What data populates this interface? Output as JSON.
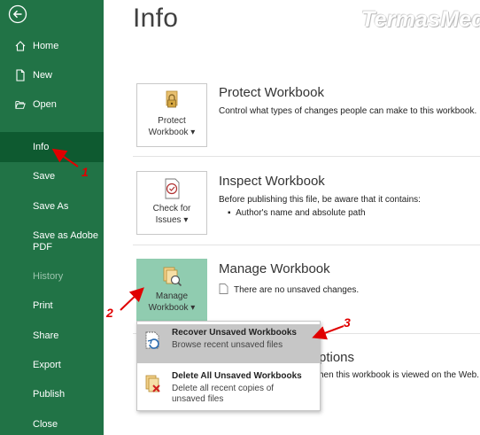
{
  "sidebar": {
    "items": [
      {
        "label": "Home",
        "icon": "home-icon"
      },
      {
        "label": "New",
        "icon": "new-document-icon"
      },
      {
        "label": "Open",
        "icon": "open-folder-icon"
      },
      {
        "label": "Info"
      },
      {
        "label": "Save"
      },
      {
        "label": "Save As"
      },
      {
        "label": "Save as Adobe",
        "label2": "PDF"
      },
      {
        "label": "History",
        "disabled": true
      },
      {
        "label": "Print"
      },
      {
        "label": "Share"
      },
      {
        "label": "Export"
      },
      {
        "label": "Publish"
      },
      {
        "label": "Close"
      }
    ],
    "selected": "Info",
    "colors": {
      "background": "#217346",
      "selected": "#0e5a30",
      "disabled_text": "#9cc4ad"
    }
  },
  "main": {
    "title": "Info",
    "watermark": "TermasMedia"
  },
  "sections": {
    "protect": {
      "tile_line1": "Protect",
      "tile_line2": "Workbook",
      "title": "Protect Workbook",
      "desc": "Control what types of changes people can make to this workbook."
    },
    "inspect": {
      "tile_line1": "Check for",
      "tile_line2": "Issues",
      "title": "Inspect Workbook",
      "desc": "Before publishing this file, be aware that it contains:",
      "bullet": "Author's name and absolute path"
    },
    "manage": {
      "tile_line1": "Manage",
      "tile_line2": "Workbook",
      "title": "Manage Workbook",
      "desc": "There are no unsaved changes."
    },
    "browser": {
      "title_fragment": "ptions",
      "desc_fragment": "hen this workbook is viewed on the Web."
    }
  },
  "dropdown": {
    "recover": {
      "title": "Recover Unsaved Workbooks",
      "desc": "Browse recent unsaved files"
    },
    "delete": {
      "title": "Delete All Unsaved Workbooks",
      "desc1": "Delete all recent copies of",
      "desc2": "unsaved files"
    }
  },
  "annotations": {
    "n1": "1",
    "n2": "2",
    "n3": "3",
    "color": "#e00000"
  },
  "colors": {
    "accent": "#217346",
    "tile_active": "#90ccb0",
    "menu_highlight": "#c6c6c6"
  }
}
